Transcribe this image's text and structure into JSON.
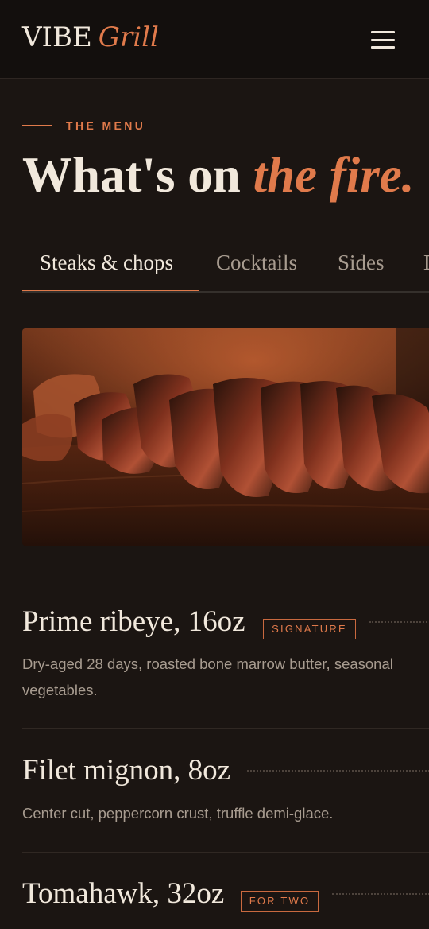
{
  "header": {
    "brand_main": "VIBE",
    "brand_accent": "Grill",
    "menu_icon": "hamburger-menu-icon"
  },
  "intro": {
    "eyebrow": "THE MENU",
    "title_main": "What's on ",
    "title_accent": "the fire."
  },
  "tabs": [
    {
      "label": "Steaks & chops",
      "active": true
    },
    {
      "label": "Cocktails",
      "active": false
    },
    {
      "label": "Sides",
      "active": false
    },
    {
      "label": "D",
      "active": false
    }
  ],
  "hero": {
    "subject": "sliced steak on wooden board"
  },
  "menu": {
    "items": [
      {
        "name": "Prime ribeye, 16oz",
        "tag": "SIGNATURE",
        "description": "Dry-aged 28 days, roasted bone marrow butter, seasonal vegetables."
      },
      {
        "name": "Filet mignon, 8oz",
        "tag": "",
        "description": "Center cut, peppercorn crust, truffle demi-glace."
      },
      {
        "name": "Tomahawk, 32oz",
        "tag": "FOR TWO",
        "description": ""
      }
    ]
  },
  "colors": {
    "background": "#1b1512",
    "header": "#130f0d",
    "accent": "#e07a4b",
    "text": "#f1e8dc",
    "muted": "#a89c90"
  }
}
